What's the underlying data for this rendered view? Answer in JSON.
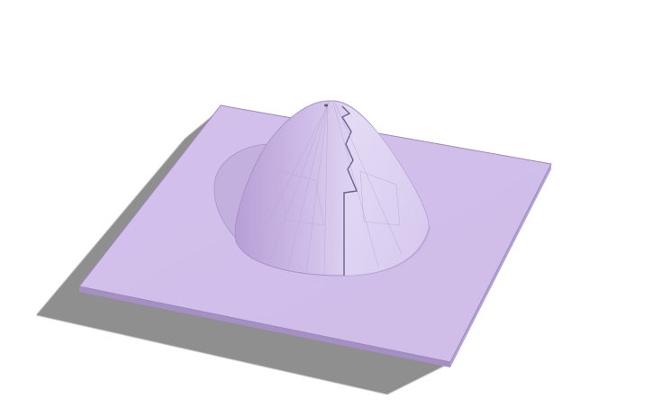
{
  "scene": {
    "background_color": "#ffffff",
    "object_color": "#d5c5ea",
    "object_shade_color": "#bfa9dd",
    "plate_edge_color": "#9a8ab4",
    "shadow_color": "#8d8d8d",
    "objects": [
      {
        "name": "base-plate",
        "shape": "thin square plate"
      },
      {
        "name": "dome",
        "shape": "cone-like dome with curved cut seam"
      },
      {
        "name": "drop-shadow",
        "shape": "soft ground shadow"
      }
    ]
  }
}
